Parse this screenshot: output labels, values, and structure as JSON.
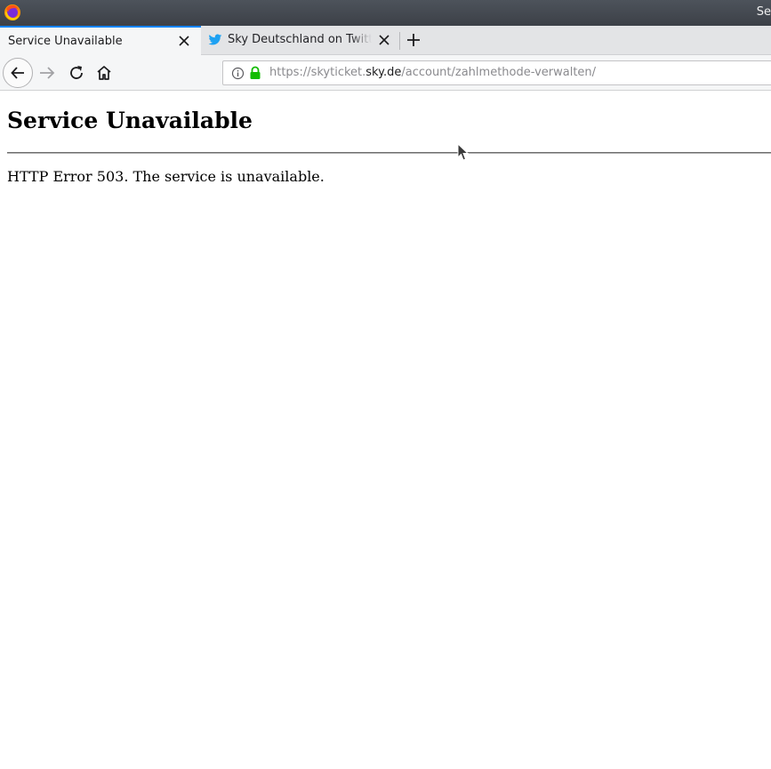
{
  "window": {
    "title": "Se",
    "app_icon": "firefox-icon"
  },
  "tabs": [
    {
      "label": "Service Unavailable",
      "active": true
    },
    {
      "label": "Sky Deutschland on Twitter",
      "active": false,
      "favicon": "twitter-bird-icon"
    }
  ],
  "toolbar": {
    "url_scheme": "https://skyticket.",
    "url_host": "sky.de",
    "url_path": "/account/zahlmethode-verwalten/",
    "icons": [
      "back-arrow-icon",
      "forward-arrow-icon",
      "reload-icon",
      "home-icon",
      "info-icon",
      "lock-icon"
    ]
  },
  "page": {
    "heading": "Service Unavailable",
    "message": "HTTP Error 503. The service is unavailable."
  },
  "colors": {
    "titlebar": "#43484f",
    "tab_accent": "#0a84ff",
    "lock_green": "#12bc00",
    "twitter_blue": "#1da1f2"
  }
}
